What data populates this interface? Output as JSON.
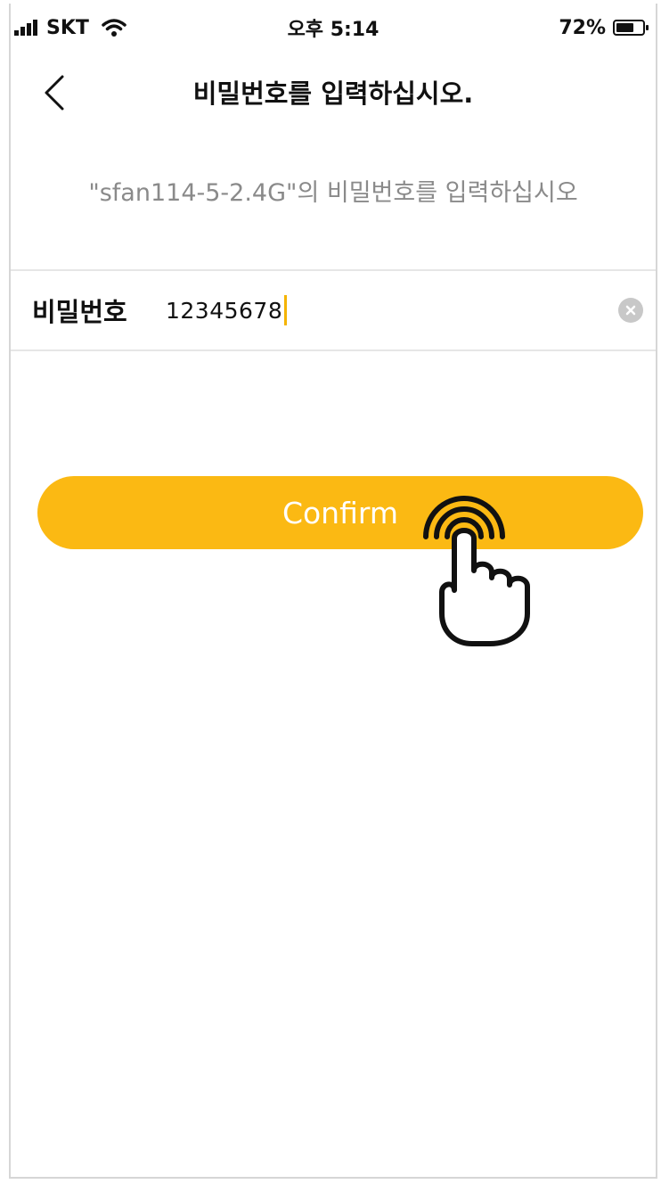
{
  "status_bar": {
    "carrier": "SKT",
    "time": "오후 5:14",
    "battery_percent": "72%",
    "battery_level": 0.72,
    "icons": [
      "signal-bars-icon",
      "wifi-icon",
      "battery-icon"
    ]
  },
  "nav": {
    "title": "비밀번호를 입력하십시오.",
    "back_icon": "chevron-left-icon"
  },
  "prompt": {
    "text": "\"sfan114-5-2.4G\"의 비밀번호를 입력하십시오"
  },
  "password_field": {
    "label": "비밀번호",
    "value": "12345678",
    "clear_icon": "clear-circle-icon"
  },
  "confirm": {
    "label": "Confirm"
  },
  "overlay": {
    "icon": "tap-hand-icon"
  },
  "colors": {
    "accent": "#fbb913",
    "caret": "#f5b400",
    "subtitle_text": "#8a8a8a"
  }
}
